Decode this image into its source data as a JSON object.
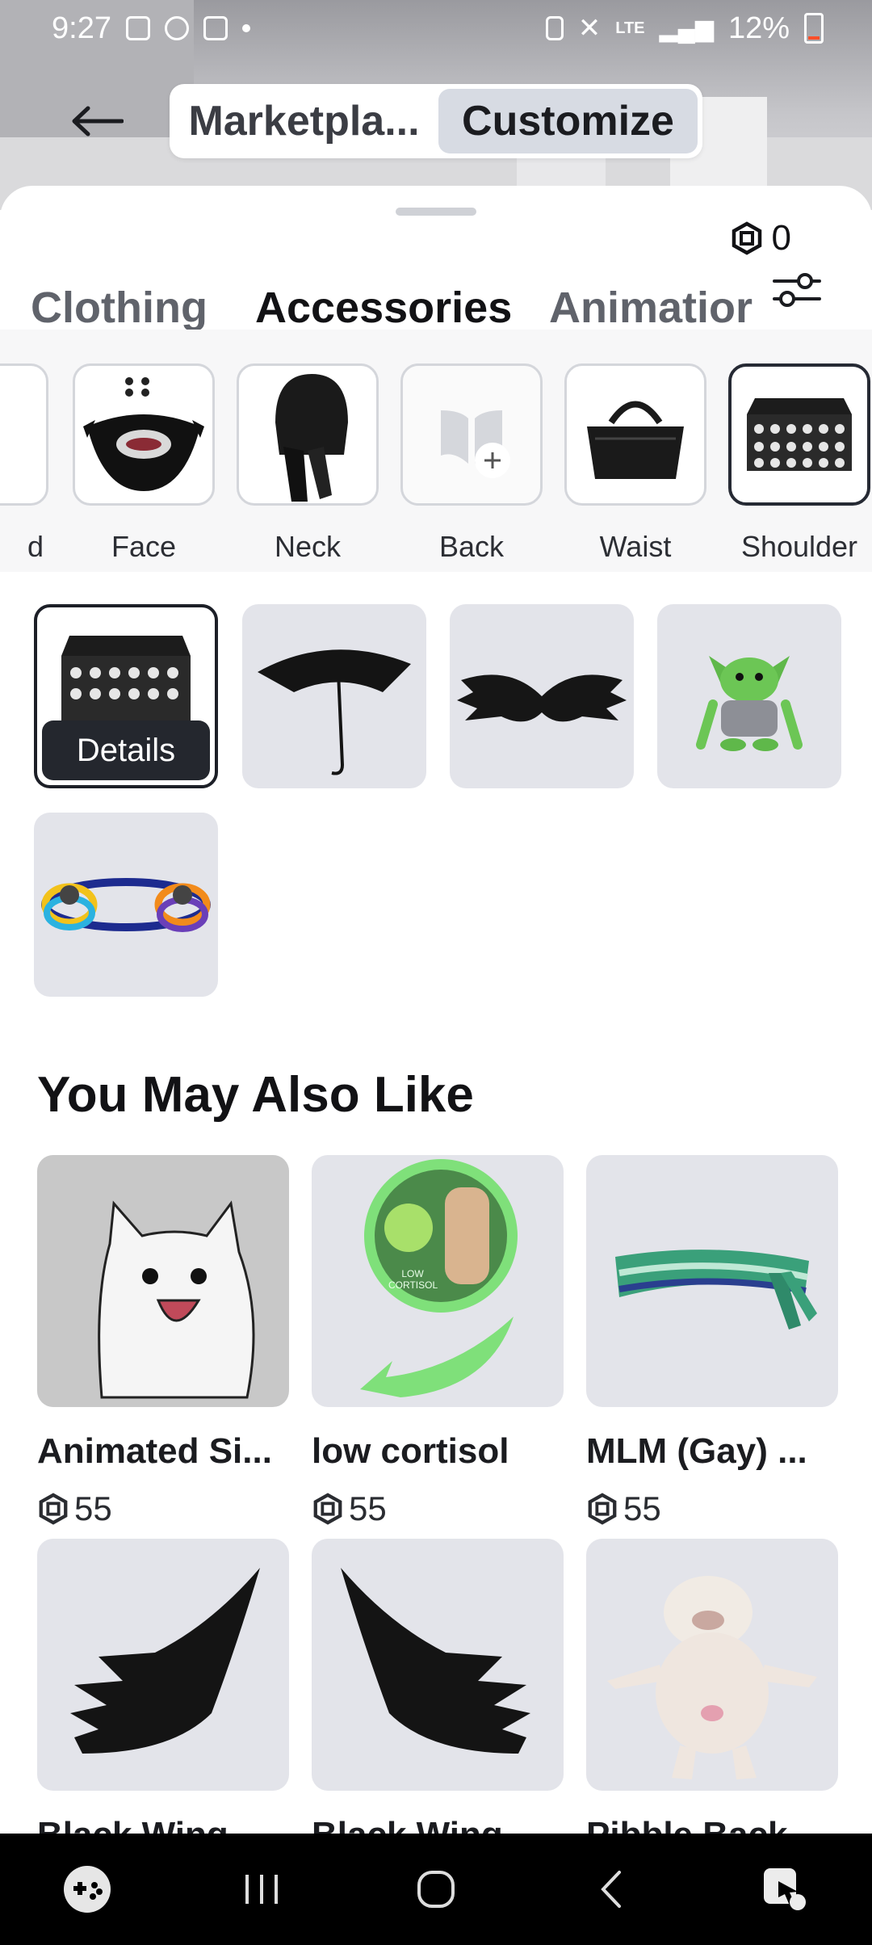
{
  "status_bar": {
    "time": "9:27",
    "battery": "12%",
    "network": "LTE"
  },
  "header": {
    "segments": [
      {
        "label": "Marketpla...",
        "active": false
      },
      {
        "label": "Customize",
        "active": true
      }
    ]
  },
  "robux": {
    "balance": "0"
  },
  "tabs": [
    {
      "label": "Clothing",
      "active": false
    },
    {
      "label": "Accessories",
      "active": true
    },
    {
      "label": "Animatior",
      "active": false
    }
  ],
  "categories": [
    {
      "label": "d",
      "selected": false
    },
    {
      "label": "Face",
      "selected": false
    },
    {
      "label": "Neck",
      "selected": false
    },
    {
      "label": "Back",
      "selected": false
    },
    {
      "label": "Waist",
      "selected": false
    },
    {
      "label": "Shoulder",
      "selected": true
    }
  ],
  "equipped": {
    "details_label": "Details",
    "items": [
      "spiked-shoulder-pads",
      "umbrella",
      "black-wings",
      "green-creature",
      "rainbow-rings"
    ]
  },
  "recommendations": {
    "title": "You May Also Like",
    "items": [
      {
        "name": "Animated Si...",
        "price": "55"
      },
      {
        "name": "low cortisol",
        "price": "55"
      },
      {
        "name": "MLM (Gay) ...",
        "price": "55"
      },
      {
        "name": "Black Wing",
        "price": ""
      },
      {
        "name": "Black Wing",
        "price": ""
      },
      {
        "name": "Pibble Back",
        "price": ""
      }
    ],
    "thumb_text": "LOW CORTISOL"
  },
  "colors": {
    "accent": "#121215",
    "tile_bg": "#e3e4ea",
    "nav_bg": "#000000",
    "battery_low": "#ff4f29"
  }
}
